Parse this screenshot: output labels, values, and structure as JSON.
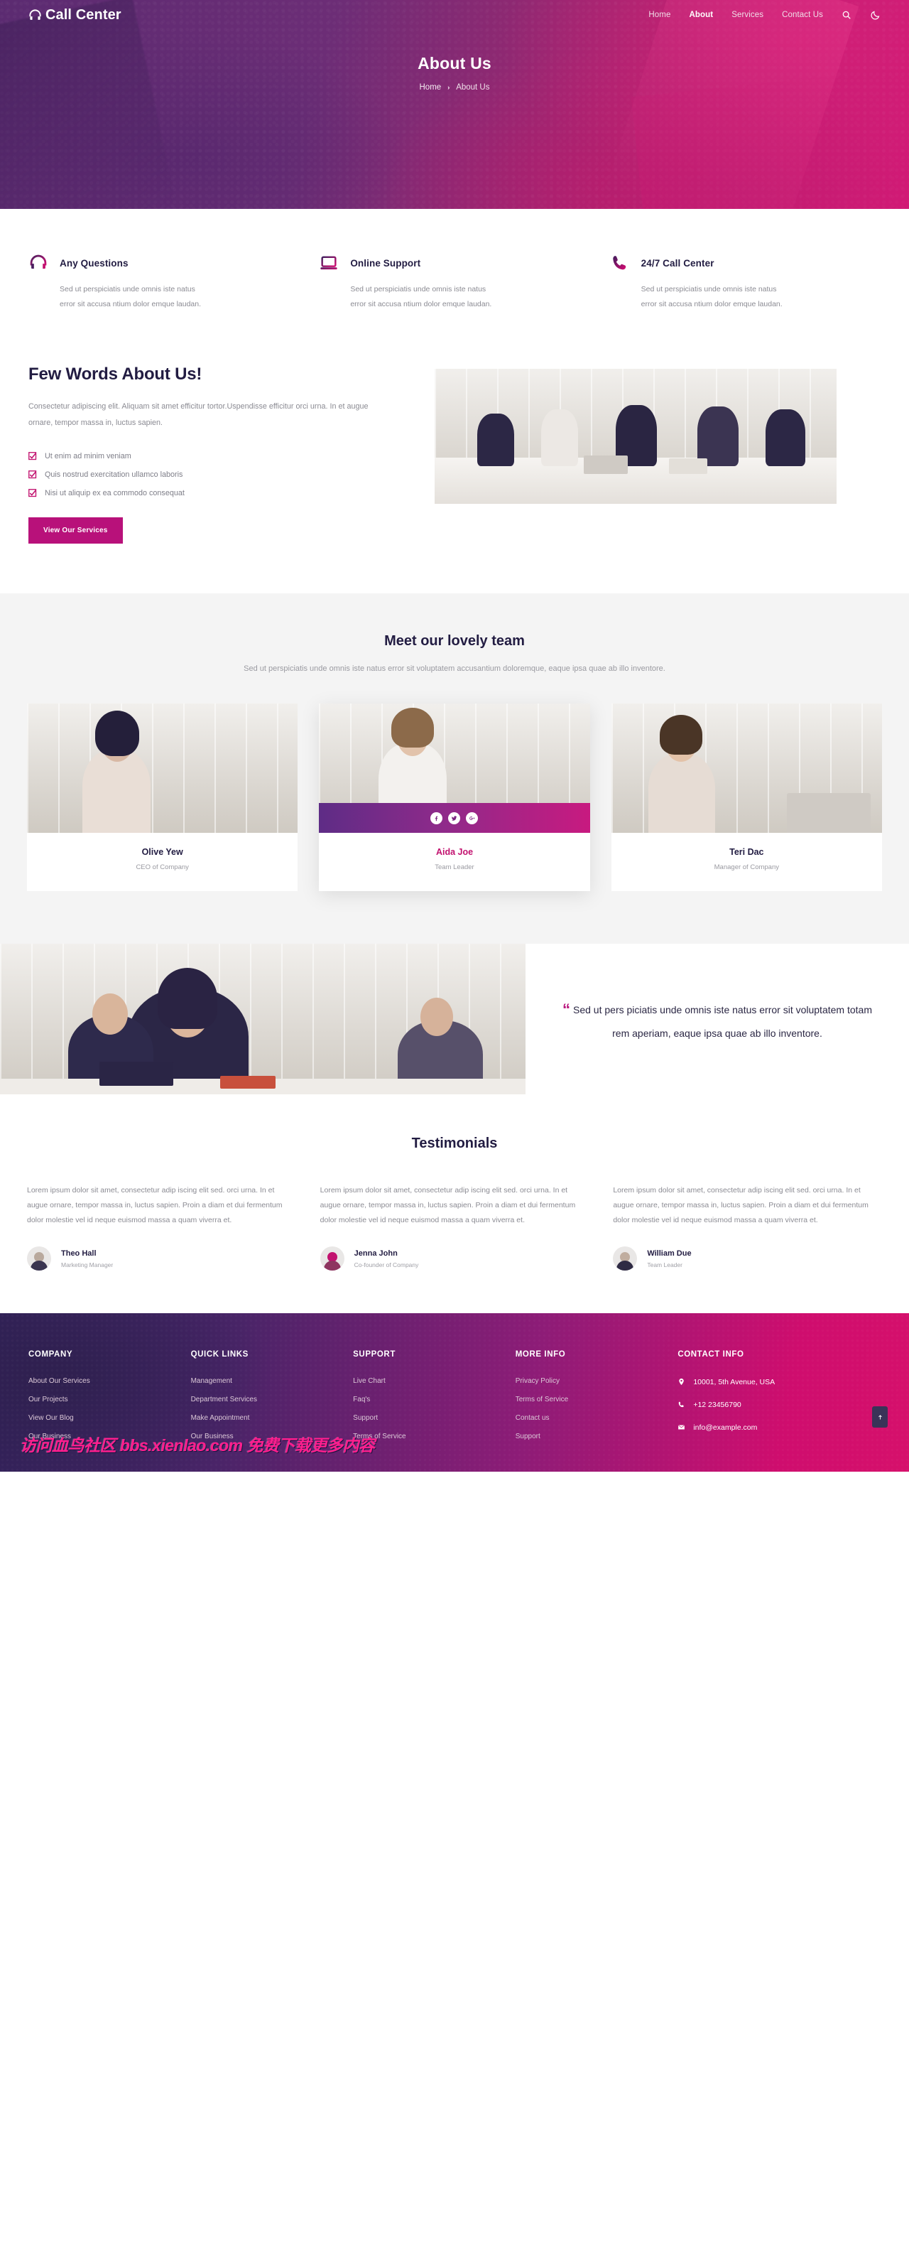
{
  "brand": {
    "name": "Call Center",
    "logo_icon": "headset-icon"
  },
  "nav": {
    "items": [
      {
        "label": "Home",
        "active": false
      },
      {
        "label": "About",
        "active": true
      },
      {
        "label": "Services",
        "active": false
      },
      {
        "label": "Contact Us",
        "active": false
      }
    ],
    "search_icon": "search-icon",
    "theme_icon": "moon-icon"
  },
  "hero": {
    "title": "About Us",
    "breadcrumb_home": "Home",
    "breadcrumb_sep": "›",
    "breadcrumb_current": "About Us"
  },
  "features": [
    {
      "icon": "headset-icon",
      "title": "Any Questions",
      "text": "Sed ut perspiciatis unde omnis iste natus error sit accusa ntium dolor emque laudan."
    },
    {
      "icon": "laptop-icon",
      "title": "Online Support",
      "text": "Sed ut perspiciatis unde omnis iste natus error sit accusa ntium dolor emque laudan."
    },
    {
      "icon": "phone-icon",
      "title": "24/7 Call Center",
      "text": "Sed ut perspiciatis unde omnis iste natus error sit accusa ntium dolor emque laudan."
    }
  ],
  "about": {
    "heading": "Few Words About Us!",
    "paragraph": "Consectetur adipiscing elit. Aliquam sit amet efficitur tortor.Uspendisse efficitur orci urna. In et augue ornare, tempor massa in, luctus sapien.",
    "checks": [
      "Ut enim ad minim veniam",
      "Quis nostrud exercitation ullamco laboris",
      "Nisi ut aliquip ex ea commodo consequat"
    ],
    "button": "View Our Services",
    "image_alt": "team-meeting-photo"
  },
  "team": {
    "heading": "Meet our lovely team",
    "subheading": "Sed ut perspiciatis unde omnis iste natus error sit voluptatem accusantium doloremque, eaque ipsa quae ab illo inventore.",
    "members": [
      {
        "name": "Olive Yew",
        "role": "CEO of Company",
        "featured": false
      },
      {
        "name": "Aida Joe",
        "role": "Team Leader",
        "featured": true
      },
      {
        "name": "Teri Dac",
        "role": "Manager of Company",
        "featured": false
      }
    ],
    "social": [
      "facebook-icon",
      "twitter-icon",
      "google-plus-icon"
    ]
  },
  "quote": {
    "mark": "“",
    "text": "Sed ut pers piciatis unde omnis iste natus error sit voluptatem totam rem aperiam, eaque ipsa quae ab illo inventore.",
    "image_alt": "call-center-agents-photo"
  },
  "testimonials": {
    "heading": "Testimonials",
    "items": [
      {
        "text": "Lorem ipsum dolor sit amet, consectetur adip iscing elit sed. orci urna. In et augue ornare, tempor massa in, luctus sapien. Proin a diam et dui fermentum dolor molestie vel id neque euismod massa a quam viverra et.",
        "name": "Theo Hall",
        "role": "Marketing Manager"
      },
      {
        "text": "Lorem ipsum dolor sit amet, consectetur adip iscing elit sed. orci urna. In et augue ornare, tempor massa in, luctus sapien. Proin a diam et dui fermentum dolor molestie vel id neque euismod massa a quam viverra et.",
        "name": "Jenna John",
        "role": "Co-founder of Company"
      },
      {
        "text": "Lorem ipsum dolor sit amet, consectetur adip iscing elit sed. orci urna. In et augue ornare, tempor massa in, luctus sapien. Proin a diam et dui fermentum dolor molestie vel id neque euismod massa a quam viverra et.",
        "name": "William Due",
        "role": "Team Leader"
      }
    ]
  },
  "footer": {
    "columns": [
      {
        "title": "COMPANY",
        "links": [
          "About Our Services",
          "Our Projects",
          "View Our Blog",
          "Our Business"
        ]
      },
      {
        "title": "QUICK LINKS",
        "links": [
          "Management",
          "Department Services",
          "Make Appointment",
          "Our Business"
        ]
      },
      {
        "title": "SUPPORT",
        "links": [
          "Live Chart",
          "Faq's",
          "Support",
          "Terms of Service"
        ]
      },
      {
        "title": "MORE INFO",
        "links": [
          "Privacy Policy",
          "Terms of Service",
          "Contact us",
          "Support"
        ]
      }
    ],
    "contact": {
      "title": "CONTACT INFO",
      "address": "10001, 5th Avenue, USA",
      "phone": "+12 23456790",
      "email": "info@example.com",
      "address_icon": "map-pin-icon",
      "phone_icon": "phone-icon",
      "email_icon": "envelope-icon"
    },
    "back_to_top_icon": "arrow-up-icon",
    "watermark": "访问血鸟社区 bbs.xienlao.com 免费下载更多内容"
  }
}
